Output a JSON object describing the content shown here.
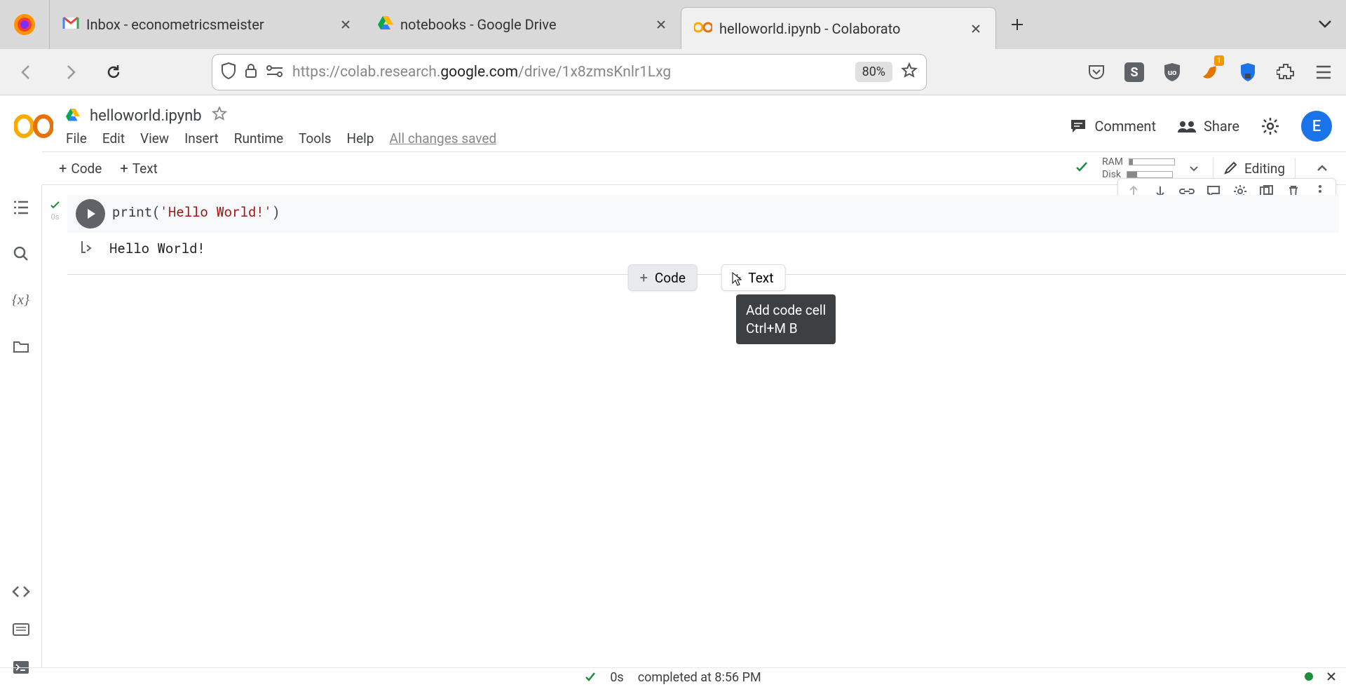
{
  "browser": {
    "tabs": [
      {
        "title": "Inbox - econometricsmeister"
      },
      {
        "title": "notebooks - Google Drive"
      },
      {
        "title": "helloworld.ipynb - Colaborato"
      }
    ],
    "url_prefix": "https://",
    "url_host_pre": "colab.research.",
    "url_host_dark": "google.com",
    "url_path": "/drive/1x8zmsKnlr1Lxg",
    "zoom": "80%",
    "ext_badge": "1"
  },
  "colab": {
    "filename": "helloworld.ipynb",
    "menus": [
      "File",
      "Edit",
      "View",
      "Insert",
      "Runtime",
      "Tools",
      "Help"
    ],
    "saved_text": "All changes saved",
    "header": {
      "comment": "Comment",
      "share": "Share",
      "avatar_initial": "E"
    },
    "toolbar": {
      "code": "Code",
      "text": "Text",
      "ram": "RAM",
      "disk": "Disk",
      "editing": "Editing"
    },
    "cell": {
      "exec_time": "0s",
      "code_fn": "print",
      "code_str": "'Hello World!'",
      "output": "Hello World!"
    },
    "insert": {
      "code": "Code",
      "text": "Text"
    },
    "tooltip": {
      "line1": "Add code cell",
      "line2": "Ctrl+M B"
    }
  },
  "status": {
    "time": "0s",
    "text": "completed at 8:56 PM"
  }
}
